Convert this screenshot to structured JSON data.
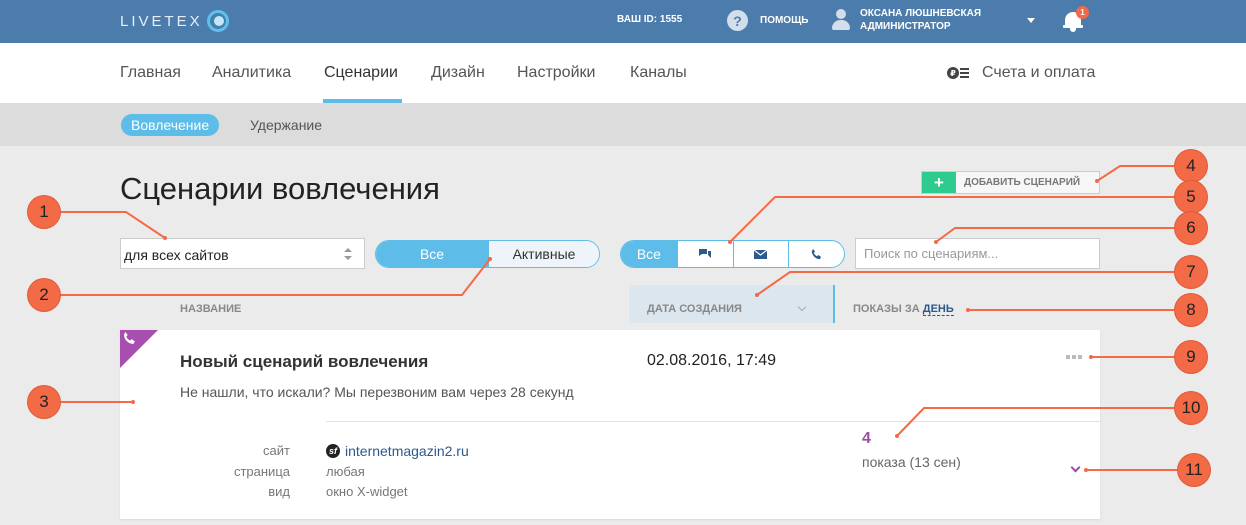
{
  "topbar": {
    "logo_text": "LIVETEX",
    "your_id": "ВАШ ID: 1555",
    "help_icon_glyph": "?",
    "help_label": "ПОМОЩЬ",
    "user_name": "ОКСАНА ЛЮШНЕВСКАЯ",
    "user_role": "АДМИНИСТРАТОР",
    "notifications_count": "1"
  },
  "mainnav": {
    "items": [
      "Главная",
      "Аналитика",
      "Сценарии",
      "Дизайн",
      "Настройки",
      "Каналы"
    ],
    "active": "Сценарии",
    "billing_label": "Счета и оплата",
    "billing_coin_glyph": "₽"
  },
  "subnav": {
    "tabs": [
      "Вовлечение",
      "Удержание"
    ],
    "active": "Вовлечение"
  },
  "page": {
    "title": "Сценарии вовлечения",
    "add_button_plus": "+",
    "add_button_label": "ДОБАВИТЬ СЦЕНАРИЙ"
  },
  "filters": {
    "site_select_value": "для всех сайтов",
    "status_options": [
      "Все",
      "Активные"
    ],
    "status_selected": "Все",
    "channel_options": [
      "Все",
      "chat-icon",
      "mail-icon",
      "phone-icon"
    ],
    "channel_selected": "Все",
    "search_placeholder": "Поиск по сценариям..."
  },
  "columns": {
    "name": "НАЗВАНИЕ",
    "date": "ДАТА СОЗДАНИЯ",
    "shows_prefix": "ПОКАЗЫ ЗА",
    "shows_period": "ДЕНЬ"
  },
  "scenarios": [
    {
      "channel_icon": "phone-icon",
      "corner_color": "#a84eae",
      "title": "Новый сценарий вовлечения",
      "created": "02.08.2016, 17:49",
      "description": "Не нашли, что искали? Мы перезвоним вам через 28 секунд",
      "meta_labels": {
        "site": "сайт",
        "page": "страница",
        "view": "вид"
      },
      "site_favicon_glyph": "sf",
      "site": "internetmagazin2.ru",
      "page": "любая",
      "view": "окно X-widget",
      "shows_count": "4",
      "shows_text": "показа (13 сен)"
    }
  ],
  "callouts": [
    "1",
    "2",
    "3",
    "4",
    "5",
    "6",
    "7",
    "8",
    "9",
    "10",
    "11"
  ],
  "colors": {
    "topbar": "#4c7cab",
    "accent": "#5dbde8",
    "callout": "#f26a46",
    "add_plus": "#2ecb8f",
    "purple": "#9b4ea6"
  }
}
